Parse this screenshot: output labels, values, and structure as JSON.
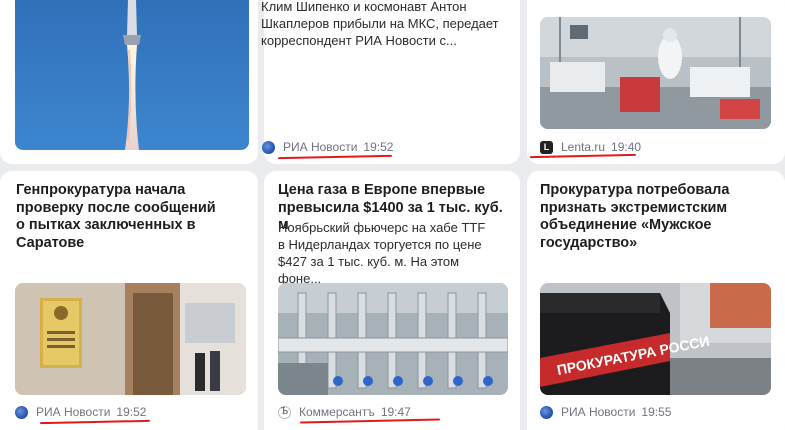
{
  "cards": [
    {
      "description": "Клим Шипенко и космонавт Антон Шкаплеров прибыли на МКС, передает корреспондент РИА Новости с...",
      "source": "РИА Новости",
      "time": "19:52",
      "image_icon": "rocket-launch-image",
      "source_icon": "ria-novosti-logo-icon"
    },
    {
      "source": "Lenta.ru",
      "time": "19:40",
      "image_icon": "hospital-ward-image",
      "source_icon": "lenta-logo-icon",
      "source_logo_letter": "L"
    },
    {
      "title": "Генпрокуратура начала проверку после сообщений о пытках заключенных в Саратове",
      "source": "РИА Новости",
      "time": "19:52",
      "image_icon": "prosecutor-building-image",
      "source_icon": "ria-novosti-logo-icon"
    },
    {
      "title": "Цена газа в Европе впервые превысила $1400 за 1 тыс. куб. м",
      "description": "Ноябрьский фьючерс на хабе TTF в Нидерландах торгуется по цене $427 за 1 тыс. куб. м. На этом фоне...",
      "source": "Коммерсантъ",
      "time": "19:47",
      "image_icon": "gas-pipelines-image",
      "source_icon": "kommersant-logo-icon",
      "source_logo_letter": "Ъ"
    },
    {
      "title": "Прокуратура потребовала признать экстремистским объединение «Мужское государство»",
      "source": "РИА Новости",
      "time": "19:55",
      "image_icon": "prosecutor-van-image",
      "source_icon": "ria-novosti-logo-icon",
      "van_text": "ПРОКУРАТУРА РОССИ"
    }
  ],
  "colors": {
    "underline": "#e0191b",
    "background": "#e9ebef",
    "card": "#ffffff",
    "source_text": "#6f7380"
  }
}
